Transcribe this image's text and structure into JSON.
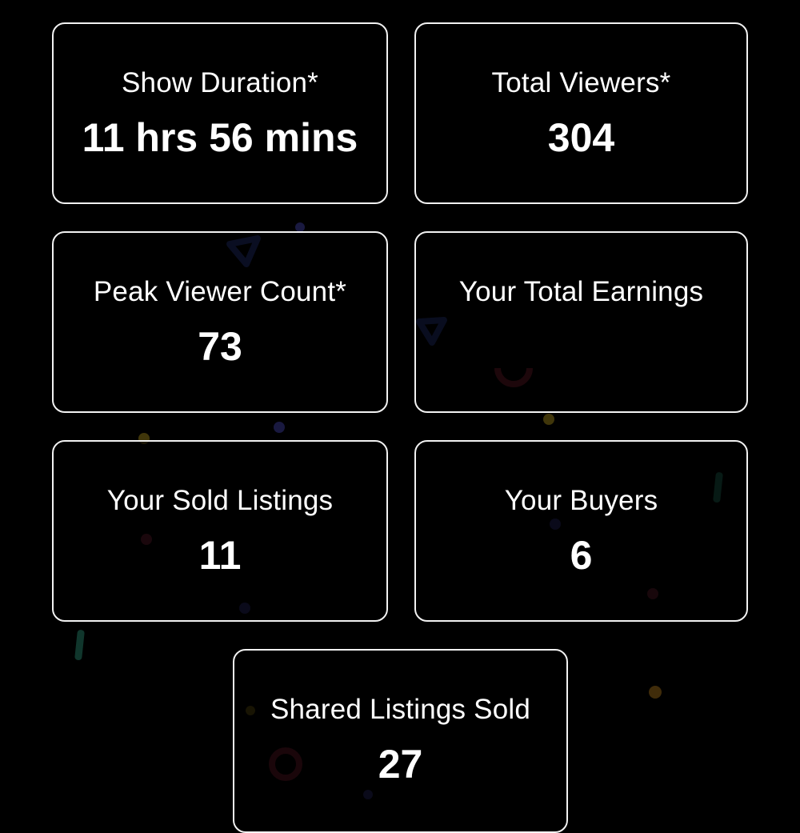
{
  "stats": {
    "show_duration": {
      "label": "Show Duration*",
      "value": "11 hrs 56 mins"
    },
    "total_viewers": {
      "label": "Total Viewers*",
      "value": "304"
    },
    "peak_viewer_count": {
      "label": "Peak Viewer Count*",
      "value": "73"
    },
    "total_earnings": {
      "label": "Your Total Earnings",
      "value": ""
    },
    "sold_listings": {
      "label": "Your Sold Listings",
      "value": "11"
    },
    "buyers": {
      "label": "Your Buyers",
      "value": "6"
    },
    "shared_listings_sold": {
      "label": "Shared Listings Sold",
      "value": "27"
    }
  },
  "colors": {
    "background": "#000000",
    "card_border": "#f2f2f2",
    "text": "#ffffff"
  }
}
